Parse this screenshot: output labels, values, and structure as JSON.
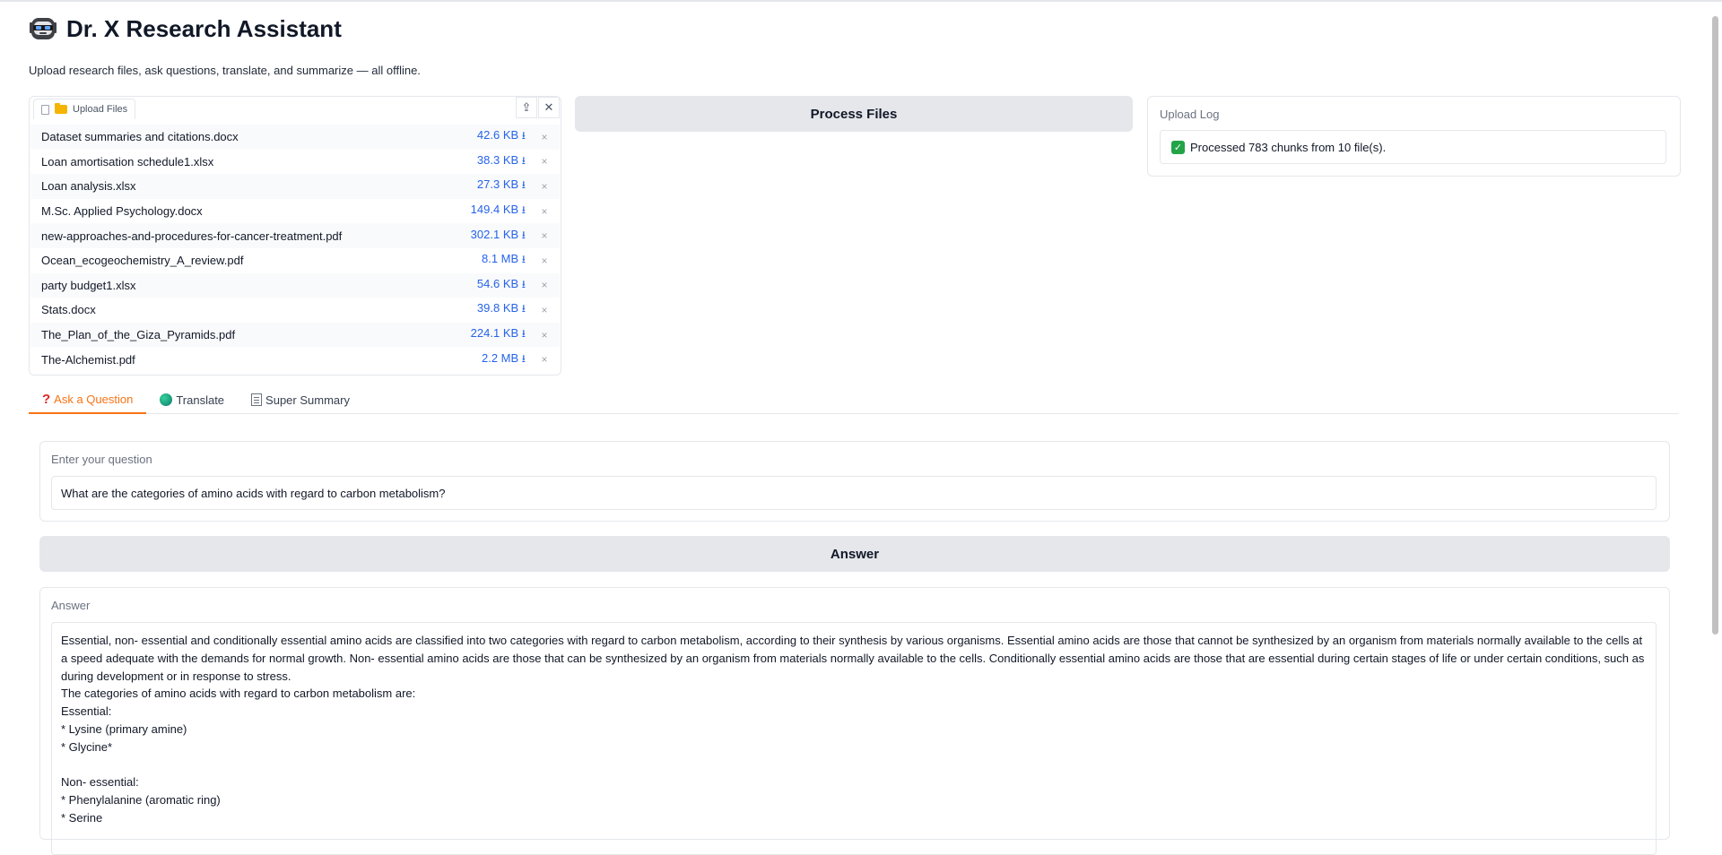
{
  "app": {
    "title": "Dr. X Research Assistant",
    "subtitle": "Upload research files, ask questions, translate, and summarize — all offline."
  },
  "upload": {
    "tab_label": "Upload Files",
    "files": [
      {
        "name": "Dataset summaries and citations.docx",
        "size": "42.6 KB"
      },
      {
        "name": "Loan amortisation schedule1.xlsx",
        "size": "38.3 KB"
      },
      {
        "name": "Loan analysis.xlsx",
        "size": "27.3 KB"
      },
      {
        "name": "M.Sc. Applied Psychology.docx",
        "size": "149.4 KB"
      },
      {
        "name": "new-approaches-and-procedures-for-cancer-treatment.pdf",
        "size": "302.1 KB"
      },
      {
        "name": "Ocean_ecogeochemistry_A_review.pdf",
        "size": "8.1 MB"
      },
      {
        "name": "party budget1.xlsx",
        "size": "54.6 KB"
      },
      {
        "name": "Stats.docx",
        "size": "39.8 KB"
      },
      {
        "name": "The_Plan_of_the_Giza_Pyramids.pdf",
        "size": "224.1 KB"
      },
      {
        "name": "The-Alchemist.pdf",
        "size": "2.2 MB"
      }
    ],
    "download_glyph": "⭳",
    "remove_glyph": "×"
  },
  "process": {
    "label": "Process Files"
  },
  "log": {
    "label": "Upload Log",
    "message": "Processed 783 chunks from 10 file(s)."
  },
  "tabs": [
    {
      "label": "Ask a Question",
      "icon": "question-icon"
    },
    {
      "label": "Translate",
      "icon": "globe-icon"
    },
    {
      "label": "Super Summary",
      "icon": "memo-icon"
    }
  ],
  "question": {
    "label": "Enter your question",
    "value": "What are the categories of amino acids with regard to carbon metabolism?"
  },
  "answer_button": {
    "label": "Answer"
  },
  "answer": {
    "label": "Answer",
    "lines": [
      "Essential, non- essential and conditionally essential amino acids are classified into two categories with regard to carbon metabolism, according to their synthesis by various organisms. Essential amino acids are those that cannot be synthesized by an organism from materials normally available to the cells at a speed adequate with the demands for normal growth. Non- essential amino acids are those that can be synthesized by an organism from materials normally available to the cells. Conditionally essential amino acids are those that are essential during certain stages of life or under certain conditions, such as during development or in response to stress.",
      "The categories of amino acids with regard to carbon metabolism are:",
      "Essential:",
      "* Lysine (primary amine)",
      "* Glycine*",
      "",
      "Non- essential:",
      "* Phenylalanine (aromatic ring)",
      "* Serine"
    ]
  },
  "colors": {
    "accent": "#f97316",
    "link": "#2563eb",
    "button_bg": "#e5e7eb"
  }
}
